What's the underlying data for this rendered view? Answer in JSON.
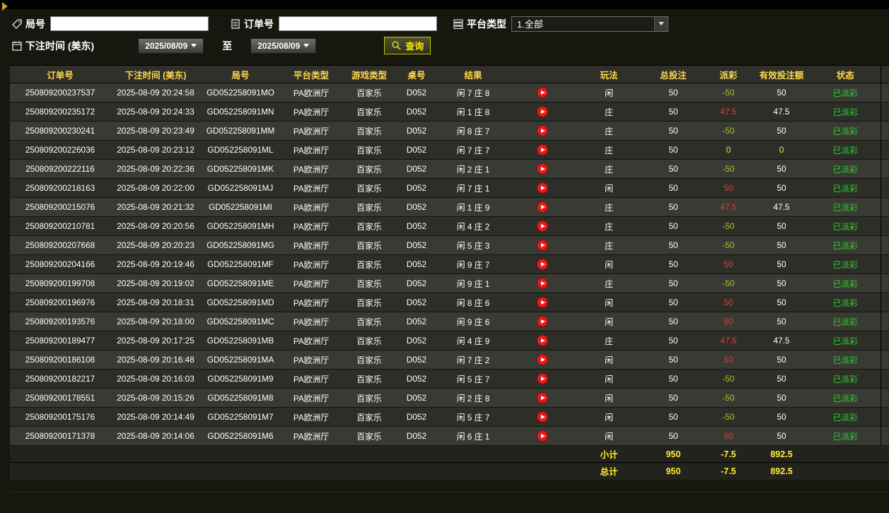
{
  "filters": {
    "round_label": "局号",
    "round_value": "",
    "order_label": "订单号",
    "order_value": "",
    "platform_label": "平台类型",
    "platform_value": "1.全部",
    "bet_time_label": "下注时间 (美东)",
    "date_from": "2025/08/09",
    "to_label": "至",
    "date_to": "2025/08/09",
    "search_label": "查询"
  },
  "table": {
    "headers": [
      "订单号",
      "下注时间 (美东)",
      "局号",
      "平台类型",
      "游戏类型",
      "桌号",
      "结果",
      "",
      "玩法",
      "总投注",
      "派彩",
      "有效投注额",
      "状态"
    ],
    "rows": [
      {
        "order_no": "250809200237537",
        "bet_time": "2025-08-09 20:24:58",
        "round_no": "GD052258091MO",
        "platform": "PA欧洲厅",
        "game_type": "百家乐",
        "table_no": "D052",
        "result": "闲 7 庄 8",
        "play": "闲",
        "total_bet": "50",
        "payout": "-50",
        "valid_bet": "50",
        "status": "已派彩"
      },
      {
        "order_no": "250809200235172",
        "bet_time": "2025-08-09 20:24:33",
        "round_no": "GD052258091MN",
        "platform": "PA欧洲厅",
        "game_type": "百家乐",
        "table_no": "D052",
        "result": "闲 1 庄 8",
        "play": "庄",
        "total_bet": "50",
        "payout": "47.5",
        "valid_bet": "47.5",
        "status": "已派彩"
      },
      {
        "order_no": "250809200230241",
        "bet_time": "2025-08-09 20:23:49",
        "round_no": "GD052258091MM",
        "platform": "PA欧洲厅",
        "game_type": "百家乐",
        "table_no": "D052",
        "result": "闲 8 庄 7",
        "play": "庄",
        "total_bet": "50",
        "payout": "-50",
        "valid_bet": "50",
        "status": "已派彩"
      },
      {
        "order_no": "250809200226036",
        "bet_time": "2025-08-09 20:23:12",
        "round_no": "GD052258091ML",
        "platform": "PA欧洲厅",
        "game_type": "百家乐",
        "table_no": "D052",
        "result": "闲 7 庄 7",
        "play": "庄",
        "total_bet": "50",
        "payout": "0",
        "valid_bet": "0",
        "status": "已派彩"
      },
      {
        "order_no": "250809200222116",
        "bet_time": "2025-08-09 20:22:36",
        "round_no": "GD052258091MK",
        "platform": "PA欧洲厅",
        "game_type": "百家乐",
        "table_no": "D052",
        "result": "闲 2 庄 1",
        "play": "庄",
        "total_bet": "50",
        "payout": "-50",
        "valid_bet": "50",
        "status": "已派彩"
      },
      {
        "order_no": "250809200218163",
        "bet_time": "2025-08-09 20:22:00",
        "round_no": "GD052258091MJ",
        "platform": "PA欧洲厅",
        "game_type": "百家乐",
        "table_no": "D052",
        "result": "闲 7 庄 1",
        "play": "闲",
        "total_bet": "50",
        "payout": "50",
        "valid_bet": "50",
        "status": "已派彩"
      },
      {
        "order_no": "250809200215076",
        "bet_time": "2025-08-09 20:21:32",
        "round_no": "GD052258091MI",
        "platform": "PA欧洲厅",
        "game_type": "百家乐",
        "table_no": "D052",
        "result": "闲 1 庄 9",
        "play": "庄",
        "total_bet": "50",
        "payout": "47.5",
        "valid_bet": "47.5",
        "status": "已派彩"
      },
      {
        "order_no": "250809200210781",
        "bet_time": "2025-08-09 20:20:56",
        "round_no": "GD052258091MH",
        "platform": "PA欧洲厅",
        "game_type": "百家乐",
        "table_no": "D052",
        "result": "闲 4 庄 2",
        "play": "庄",
        "total_bet": "50",
        "payout": "-50",
        "valid_bet": "50",
        "status": "已派彩"
      },
      {
        "order_no": "250809200207668",
        "bet_time": "2025-08-09 20:20:23",
        "round_no": "GD052258091MG",
        "platform": "PA欧洲厅",
        "game_type": "百家乐",
        "table_no": "D052",
        "result": "闲 5 庄 3",
        "play": "庄",
        "total_bet": "50",
        "payout": "-50",
        "valid_bet": "50",
        "status": "已派彩"
      },
      {
        "order_no": "250809200204166",
        "bet_time": "2025-08-09 20:19:46",
        "round_no": "GD052258091MF",
        "platform": "PA欧洲厅",
        "game_type": "百家乐",
        "table_no": "D052",
        "result": "闲 9 庄 7",
        "play": "闲",
        "total_bet": "50",
        "payout": "50",
        "valid_bet": "50",
        "status": "已派彩"
      },
      {
        "order_no": "250809200199708",
        "bet_time": "2025-08-09 20:19:02",
        "round_no": "GD052258091ME",
        "platform": "PA欧洲厅",
        "game_type": "百家乐",
        "table_no": "D052",
        "result": "闲 9 庄 1",
        "play": "庄",
        "total_bet": "50",
        "payout": "-50",
        "valid_bet": "50",
        "status": "已派彩"
      },
      {
        "order_no": "250809200196976",
        "bet_time": "2025-08-09 20:18:31",
        "round_no": "GD052258091MD",
        "platform": "PA欧洲厅",
        "game_type": "百家乐",
        "table_no": "D052",
        "result": "闲 8 庄 6",
        "play": "闲",
        "total_bet": "50",
        "payout": "50",
        "valid_bet": "50",
        "status": "已派彩"
      },
      {
        "order_no": "250809200193576",
        "bet_time": "2025-08-09 20:18:00",
        "round_no": "GD052258091MC",
        "platform": "PA欧洲厅",
        "game_type": "百家乐",
        "table_no": "D052",
        "result": "闲 9 庄 6",
        "play": "闲",
        "total_bet": "50",
        "payout": "50",
        "valid_bet": "50",
        "status": "已派彩"
      },
      {
        "order_no": "250809200189477",
        "bet_time": "2025-08-09 20:17:25",
        "round_no": "GD052258091MB",
        "platform": "PA欧洲厅",
        "game_type": "百家乐",
        "table_no": "D052",
        "result": "闲 4 庄 9",
        "play": "庄",
        "total_bet": "50",
        "payout": "47.5",
        "valid_bet": "47.5",
        "status": "已派彩"
      },
      {
        "order_no": "250809200186108",
        "bet_time": "2025-08-09 20:16:48",
        "round_no": "GD052258091MA",
        "platform": "PA欧洲厅",
        "game_type": "百家乐",
        "table_no": "D052",
        "result": "闲 7 庄 2",
        "play": "闲",
        "total_bet": "50",
        "payout": "50",
        "valid_bet": "50",
        "status": "已派彩"
      },
      {
        "order_no": "250809200182217",
        "bet_time": "2025-08-09 20:16:03",
        "round_no": "GD052258091M9",
        "platform": "PA欧洲厅",
        "game_type": "百家乐",
        "table_no": "D052",
        "result": "闲 5 庄 7",
        "play": "闲",
        "total_bet": "50",
        "payout": "-50",
        "valid_bet": "50",
        "status": "已派彩"
      },
      {
        "order_no": "250809200178551",
        "bet_time": "2025-08-09 20:15:26",
        "round_no": "GD052258091M8",
        "platform": "PA欧洲厅",
        "game_type": "百家乐",
        "table_no": "D052",
        "result": "闲 2 庄 8",
        "play": "闲",
        "total_bet": "50",
        "payout": "-50",
        "valid_bet": "50",
        "status": "已派彩"
      },
      {
        "order_no": "250809200175176",
        "bet_time": "2025-08-09 20:14:49",
        "round_no": "GD052258091M7",
        "platform": "PA欧洲厅",
        "game_type": "百家乐",
        "table_no": "D052",
        "result": "闲 5 庄 7",
        "play": "闲",
        "total_bet": "50",
        "payout": "-50",
        "valid_bet": "50",
        "status": "已派彩"
      },
      {
        "order_no": "250809200171378",
        "bet_time": "2025-08-09 20:14:06",
        "round_no": "GD052258091M6",
        "platform": "PA欧洲厅",
        "game_type": "百家乐",
        "table_no": "D052",
        "result": "闲 6 庄 1",
        "play": "闲",
        "total_bet": "50",
        "payout": "50",
        "valid_bet": "50",
        "status": "已派彩"
      }
    ],
    "subtotal": {
      "label": "小计",
      "total_bet": "950",
      "payout": "-7.5",
      "valid_bet": "892.5"
    },
    "total": {
      "label": "总计",
      "total_bet": "950",
      "payout": "-7.5",
      "valid_bet": "892.5"
    }
  },
  "colors": {
    "payout_win": "#e23b3b",
    "payout_loss": "#9ccb2d",
    "payout_zero": "#ffe14d",
    "status_paid": "#33cc33",
    "header_text": "#ffd84d",
    "footer_text": "#ffee33",
    "search_border": "#bfcc00",
    "search_text": "#ffe400",
    "play_button": "#e31b1b"
  }
}
